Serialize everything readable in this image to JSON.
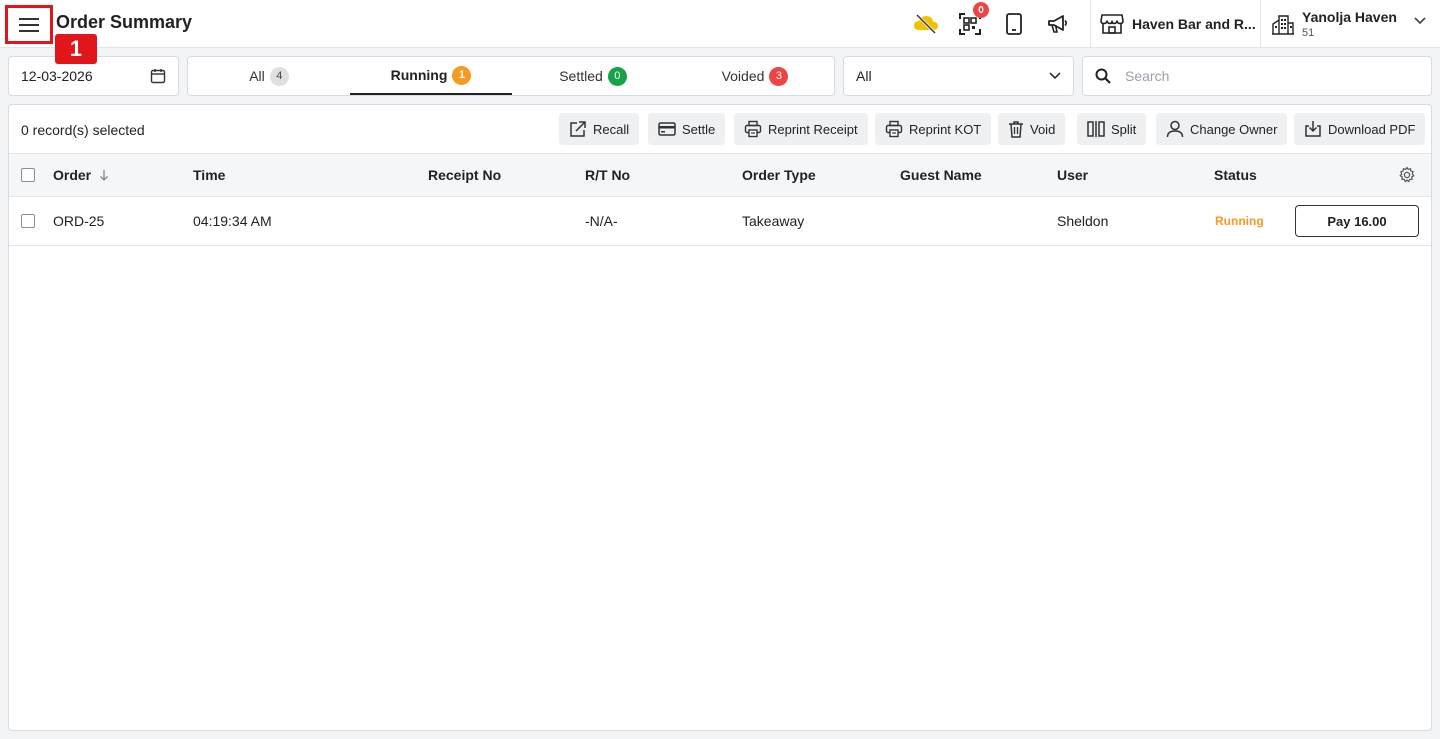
{
  "header": {
    "title": "Order Summary",
    "annotation_number": "1",
    "qr_badge_count": "0",
    "outlet_name": "Haven Bar and R...",
    "property_name": "Yanolja Haven",
    "property_number": "51"
  },
  "filters": {
    "date": "12-03-2026",
    "tabs": [
      {
        "label": "All",
        "count": "4",
        "color": "#e0e0e0"
      },
      {
        "label": "Running",
        "count": "1",
        "color": "#f59a23"
      },
      {
        "label": "Settled",
        "count": "0",
        "color": "#16a34a"
      },
      {
        "label": "Voided",
        "count": "3",
        "color": "#ef4444"
      }
    ],
    "active_tab": "Running",
    "select_value": "All",
    "search_placeholder": "Search"
  },
  "toolbar": {
    "selected_text": "0 record(s) selected",
    "buttons": [
      {
        "label": "Recall",
        "icon": "external-link-icon"
      },
      {
        "label": "Settle",
        "icon": "credit-card-icon"
      },
      {
        "label": "Reprint Receipt",
        "icon": "printer-icon"
      },
      {
        "label": "Reprint KOT",
        "icon": "printer-icon"
      },
      {
        "label": "Void",
        "icon": "trash-icon"
      },
      {
        "label": "Split",
        "icon": "split-icon"
      },
      {
        "label": "Change Owner",
        "icon": "user-icon"
      },
      {
        "label": "Download PDF",
        "icon": "download-icon"
      }
    ]
  },
  "table": {
    "columns": [
      "Order",
      "Time",
      "Receipt No",
      "R/T No",
      "Order Type",
      "Guest Name",
      "User",
      "Status"
    ],
    "rows": [
      {
        "order": "ORD-25",
        "time": "04:19:34 AM",
        "receipt_no": "",
        "rt_no": "-N/A-",
        "order_type": "Takeaway",
        "guest_name": "",
        "user": "Sheldon",
        "status": "Running",
        "action": "Pay 16.00"
      }
    ]
  },
  "colors": {
    "accent_red": "#e0161b",
    "running_orange": "#f59a23",
    "cloud_yellow": "#f2c200"
  }
}
